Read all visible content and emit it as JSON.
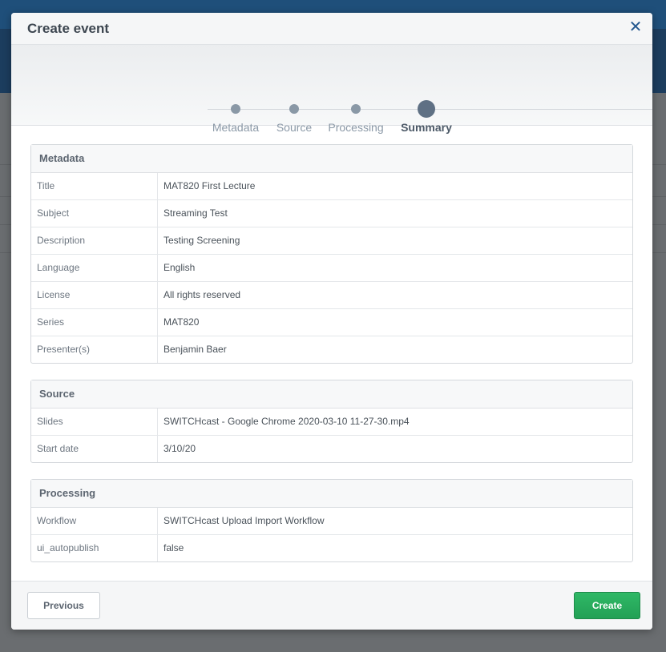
{
  "modal": {
    "title": "Create event",
    "close_icon": "close-icon"
  },
  "wizard": {
    "steps": [
      {
        "label": "Metadata",
        "state": "done"
      },
      {
        "label": "Source",
        "state": "done"
      },
      {
        "label": "Processing",
        "state": "done"
      },
      {
        "label": "Summary",
        "state": "active"
      }
    ]
  },
  "summary": {
    "metadata": {
      "heading": "Metadata",
      "rows": [
        {
          "key": "Title",
          "value": "MAT820 First Lecture"
        },
        {
          "key": "Subject",
          "value": "Streaming Test"
        },
        {
          "key": "Description",
          "value": "Testing Screening"
        },
        {
          "key": "Language",
          "value": "English"
        },
        {
          "key": "License",
          "value": "All rights reserved"
        },
        {
          "key": "Series",
          "value": "MAT820"
        },
        {
          "key": "Presenter(s)",
          "value": "Benjamin Baer"
        }
      ]
    },
    "source": {
      "heading": "Source",
      "rows": [
        {
          "key": "Slides",
          "value": "SWITCHcast - Google Chrome 2020-03-10 11-27-30.mp4"
        },
        {
          "key": "Start date",
          "value": "3/10/20"
        }
      ]
    },
    "processing": {
      "heading": "Processing",
      "rows": [
        {
          "key": "Workflow",
          "value": "SWITCHcast Upload Import Workflow"
        },
        {
          "key": "ui_autopublish",
          "value": "false"
        }
      ]
    }
  },
  "footer": {
    "previous_label": "Previous",
    "create_label": "Create"
  },
  "colors": {
    "accent_blue": "#24588f",
    "create_green": "#22a055",
    "step_active": "#4c5967"
  }
}
